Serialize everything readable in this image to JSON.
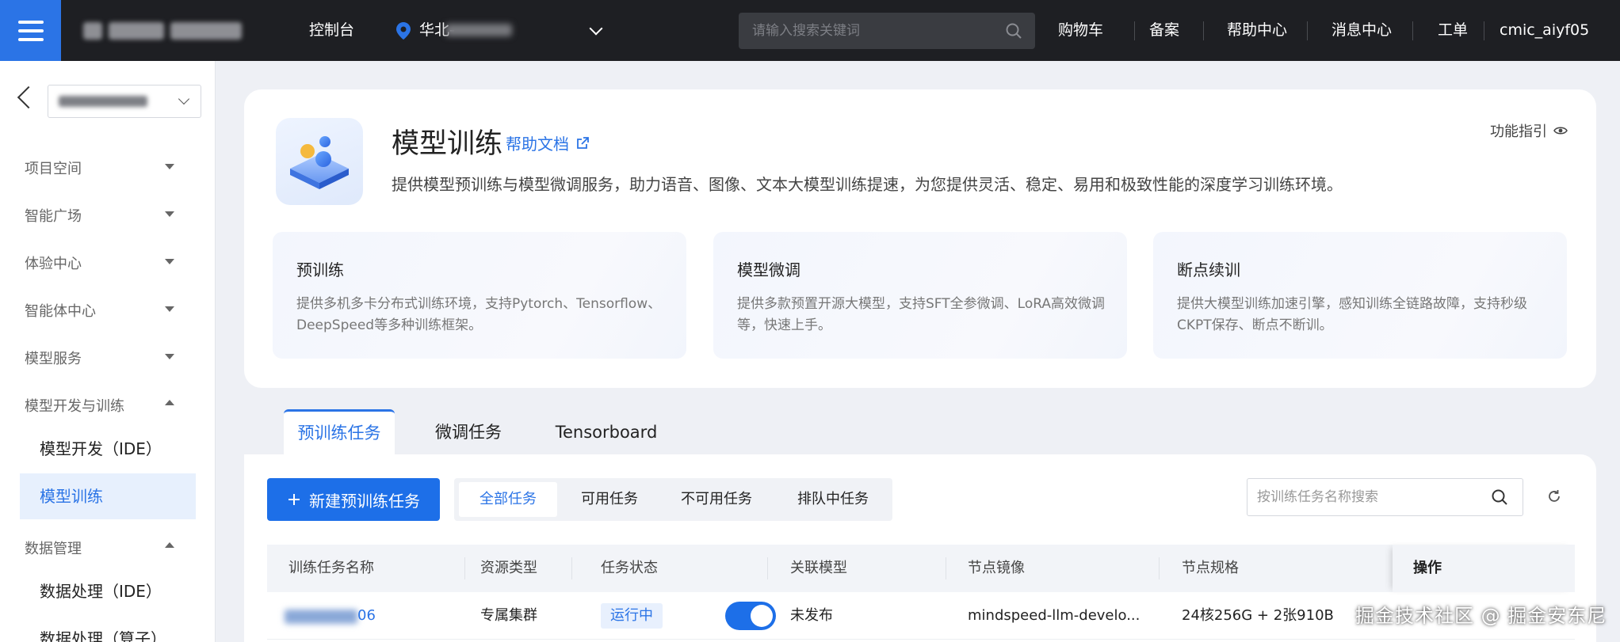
{
  "topbar": {
    "console": "控制台",
    "region": "华北-",
    "search_placeholder": "请输入搜索关键词",
    "links": [
      "购物车",
      "备案",
      "帮助中心",
      "消息中心",
      "工单"
    ],
    "user": "cmic_aiyf05"
  },
  "sidebar": {
    "groups": [
      {
        "label": "项目空间",
        "expanded": false
      },
      {
        "label": "智能广场",
        "expanded": false
      },
      {
        "label": "体验中心",
        "expanded": false
      },
      {
        "label": "智能体中心",
        "expanded": false
      },
      {
        "label": "模型服务",
        "expanded": false
      },
      {
        "label": "模型开发与训练",
        "expanded": true
      },
      {
        "label": "数据管理",
        "expanded": true
      }
    ],
    "dev_items": [
      "模型开发（IDE）",
      "模型训练"
    ],
    "data_items": [
      "数据处理（IDE）",
      "数据处理（算子）"
    ]
  },
  "intro": {
    "title": "模型训练",
    "help_doc": "帮助文档",
    "guide": "功能指引",
    "description": "提供模型预训练与模型微调服务，助力语音、图像、文本大模型训练提速，为您提供灵活、稳定、易用和极致性能的深度学习训练环境。",
    "features": [
      {
        "title": "预训练",
        "desc": "提供多机多卡分布式训练环境，支持Pytorch、Tensorflow、DeepSpeed等多种训练框架。"
      },
      {
        "title": "模型微调",
        "desc": "提供多款预置开源大模型，支持SFT全参微调、LoRA高效微调等，快速上手。"
      },
      {
        "title": "断点续训",
        "desc": "提供大模型训练加速引擎，感知训练全链路故障，支持秒级CKPT保存、断点不断训。"
      }
    ]
  },
  "tabs": [
    "预训练任务",
    "微调任务",
    "Tensorboard"
  ],
  "toolbar": {
    "new_button": "新建预训练任务",
    "filters": [
      "全部任务",
      "可用任务",
      "不可用任务",
      "排队中任务"
    ],
    "search_placeholder": "按训练任务名称搜索"
  },
  "table": {
    "columns": [
      "训练任务名称",
      "资源类型",
      "任务状态",
      "关联模型",
      "节点镜像",
      "节点规格",
      "操作"
    ],
    "rows": [
      {
        "name": "06",
        "resource_type": "专属集群",
        "status": "运行中",
        "model": "未发布",
        "image": "mindspeed-llm-develo...",
        "spec": "24核256G + 2张910B"
      }
    ]
  },
  "watermark": "掘金技术社区 @ 掘金安东尼",
  "colors": {
    "accent": "#2b74e6",
    "topbar": "#1e1f23",
    "page_bg": "#eef0f5"
  }
}
